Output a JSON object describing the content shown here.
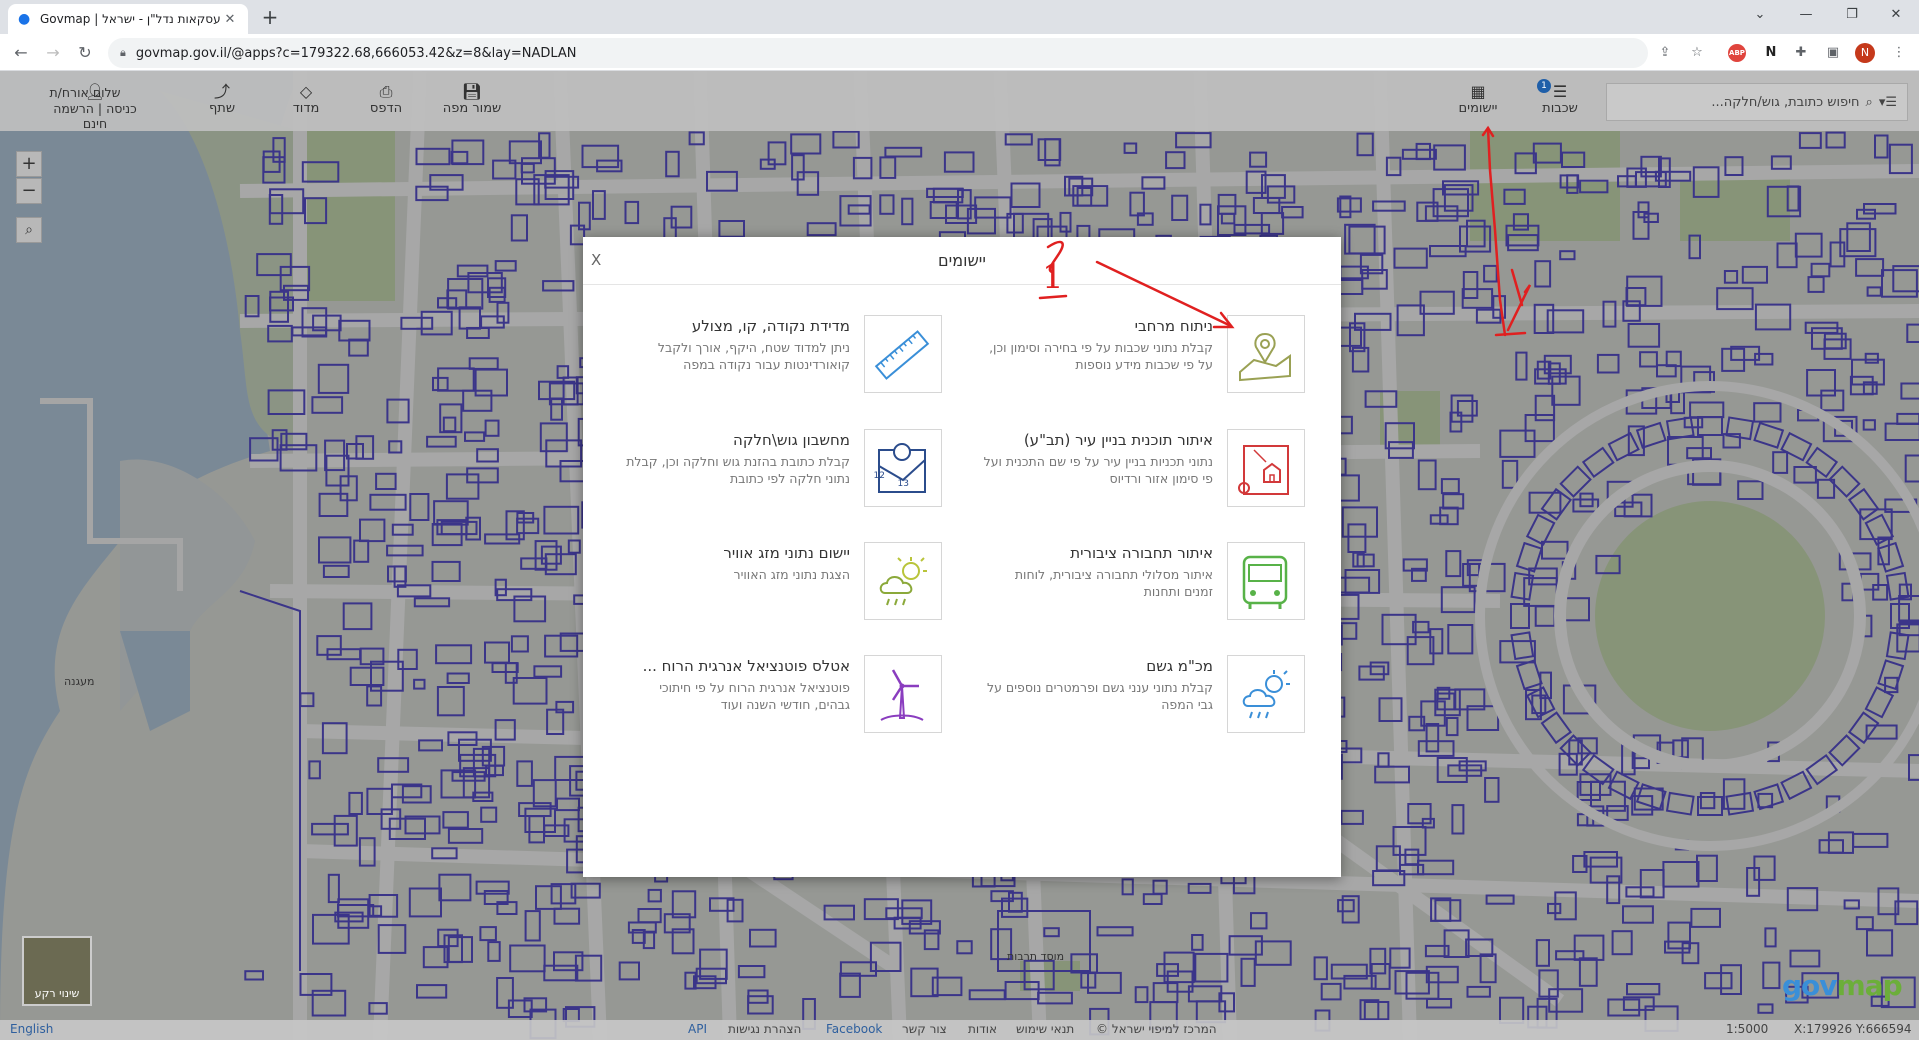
{
  "browser": {
    "tab_title": "Govmap | עסקאות נדל\"ן - ישראל ...",
    "tab_icon": "map-pin-icon",
    "url": "govmap.gov.il/@apps?c=179322.68,666053.42&z=8&lay=NADLAN",
    "avatar_letter": "N",
    "abp_label": "ABP"
  },
  "govmap": {
    "search_placeholder": "חיפוש כתובת, גוש/חלקה...",
    "layers_label": "שכבות",
    "layers_badge": "1",
    "apps_label": "יישומים",
    "save_map_label": "שמור מפה",
    "print_label": "הדפס",
    "measure_label": "מדוד",
    "share_label": "שתף",
    "greeting": "שלום אורח/ת",
    "login_label": "כניסה | הרשמה חינם",
    "basemap_label": "שינוי רקע"
  },
  "status_bar": {
    "language": "English",
    "links": [
      "API",
      "הצהרת נגישות",
      "Facebook",
      "צור קשר",
      "אודות",
      "תנאי שימוש",
      "© המרכז למיפוי ישראל"
    ],
    "scale": "1:5000",
    "coords": "X:179926 Y:666594"
  },
  "modal": {
    "title": "יישומים",
    "close_label": "X",
    "apps": [
      {
        "name": "ניתוח מרחבי",
        "desc": "קבלת נתוני שכבות על פי בחירה וסימון וכן, על פי שכבות מידע נוספות",
        "icon": "map-location-icon"
      },
      {
        "name": "מדידת נקודה, קו, מצולע",
        "desc": "ניתן למדוד שטח, היקף, אורך ולקבל קואורדינטות עבור נקודה במפה",
        "icon": "ruler-icon"
      },
      {
        "name": "איתור תוכנית בניין עיר (תב\"ע)",
        "desc": "נתוני תכניות בניין עיר על פי שם התכנית ועל פי סימון אזור ורדיוס",
        "icon": "building-plan-icon"
      },
      {
        "name": "מחשבון גוש\\חלקה",
        "desc": "קבלת כתובת בהזנת גוש וחלקה וכן, קבלת נתוני חלקה לפי כתובת",
        "icon": "parcel-calculator-icon"
      },
      {
        "name": "איתור תחבורה ציבורית",
        "desc": "איתור מסלולי תחבורה ציבורית, לוחות זמנים ותחנות",
        "icon": "bus-icon"
      },
      {
        "name": "יישום נתוני מזג אוויר",
        "desc": "הצגת נתוני מזג האוויר",
        "icon": "weather-icon"
      },
      {
        "name": "מכ\"מ גשם",
        "desc": "קבלת נתוני ענני גשם ופרמטרים נוספים על גבי המפה",
        "icon": "rain-radar-icon"
      },
      {
        "name": "אטלס פוטנציאל אנרגית הרוח ...",
        "desc": "פוטנציאל אנרגית הרוח על פי חיתוכי גבהים, חודשי השנה ועוד",
        "icon": "wind-turbine-icon"
      }
    ]
  },
  "map_labels": {
    "museum": "מוסד תרבות",
    "marina": "מעגנה"
  },
  "annotation": {
    "number": "1",
    "color": "#e02020"
  },
  "colors": {
    "building_stroke": "#2a1fb8",
    "water": "#9db8cf",
    "road": "#eeeeee",
    "park": "#b5cc9a",
    "logo_gov": "#3a8fd8",
    "logo_map": "#6cae3a"
  }
}
